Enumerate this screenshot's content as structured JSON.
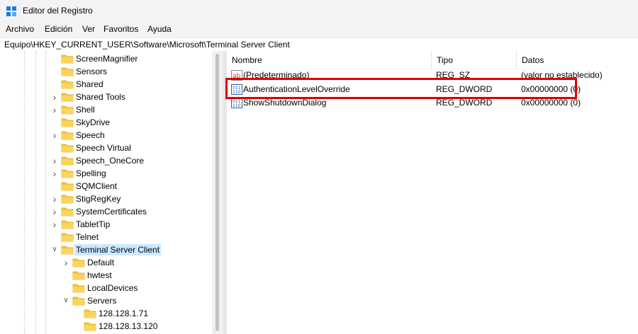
{
  "window": {
    "title": "Editor del Registro",
    "menu": [
      "Archivo",
      "Edición",
      "Ver",
      "Favoritos",
      "Ayuda"
    ]
  },
  "address": "Equipo\\HKEY_CURRENT_USER\\Software\\Microsoft\\Terminal Server Client",
  "tree": {
    "items": [
      {
        "label": "ScreenMagnifier",
        "expandable": false
      },
      {
        "label": "Sensors",
        "expandable": false
      },
      {
        "label": "Shared",
        "expandable": false
      },
      {
        "label": "Shared Tools",
        "expandable": true
      },
      {
        "label": "Shell",
        "expandable": true
      },
      {
        "label": "SkyDrive",
        "expandable": false
      },
      {
        "label": "Speech",
        "expandable": true
      },
      {
        "label": "Speech Virtual",
        "expandable": false
      },
      {
        "label": "Speech_OneCore",
        "expandable": true
      },
      {
        "label": "Spelling",
        "expandable": true
      },
      {
        "label": "SQMClient",
        "expandable": false
      },
      {
        "label": "StigRegKey",
        "expandable": true
      },
      {
        "label": "SystemCertificates",
        "expandable": true
      },
      {
        "label": "TabletTip",
        "expandable": true
      },
      {
        "label": "Telnet",
        "expandable": false
      },
      {
        "label": "Terminal Server Client",
        "expandable": true,
        "expanded": true,
        "selected": true
      },
      {
        "label": "Default",
        "expandable": true,
        "child": 1
      },
      {
        "label": "hwtest",
        "expandable": false,
        "child": 1
      },
      {
        "label": "LocalDevices",
        "expandable": false,
        "child": 1
      },
      {
        "label": "Servers",
        "expandable": true,
        "expanded": true,
        "child": 1
      },
      {
        "label": "128.128.1.71",
        "expandable": false,
        "child": 2
      },
      {
        "label": "128.128.13.120",
        "expandable": false,
        "child": 2
      }
    ]
  },
  "list": {
    "columns": [
      "Nombre",
      "Tipo",
      "Datos"
    ],
    "rows": [
      {
        "name": "(Predeterminado)",
        "type": "REG_SZ",
        "data": "(valor no establecido)",
        "icon": "string-value-icon"
      },
      {
        "name": "AuthenticationLevelOverride",
        "type": "REG_DWORD",
        "data": "0x00000000 (0)",
        "icon": "binary-value-icon"
      },
      {
        "name": "ShowShutdownDialog",
        "type": "REG_DWORD",
        "data": "0x00000000 (0)",
        "icon": "binary-value-icon"
      }
    ]
  },
  "colors": {
    "highlight_box": "#e00000",
    "selection": "#cce8ff",
    "folder": "#f8c63a"
  }
}
